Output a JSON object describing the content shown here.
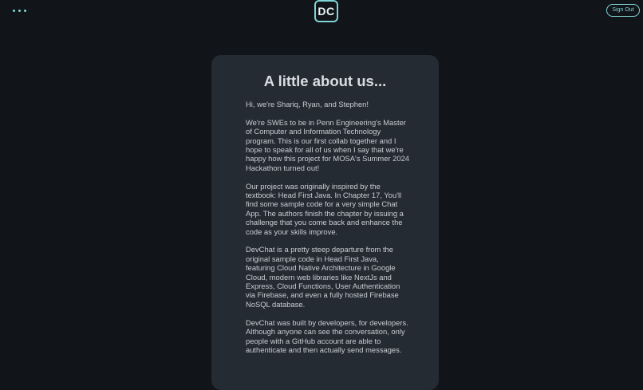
{
  "header": {
    "logo_text": "DC",
    "signout_label": "Sign Out",
    "menu_icon": "more-horizontal-icon"
  },
  "about": {
    "title": "A little about us...",
    "paragraphs": [
      "Hi, we're Shariq, Ryan, and Stephen!",
      "We're SWEs to be in Penn Engineering's Master of Computer and Information Technology program. This is our first collab together and I hope to speak for all of us when I say that we're happy how this project for MOSA's Summer 2024 Hackathon turned out!",
      "Our project was originally inspired by the textbook: Head First Java. In Chapter 17, You'll find some sample code for a very simple Chat App. The authors finish the chapter by issuing a challenge that you come back and enhance the code as your skills improve.",
      "DevChat is a pretty steep departure from the original sample code in Head First Java, featuring Cloud Native Architecture in Google Cloud, modern web libraries like NextJs and Express, Cloud Functions, User Authentication via Firebase, and even a fully hosted Firebase NoSQL database.",
      "DevChat was built by developers, for developers. Although anyone can see the conversation, only people with a GitHub account are able to authenticate and then actually send messages."
    ]
  },
  "colors": {
    "background": "#111418",
    "card": "#252b33",
    "accent": "#7fd4d4"
  }
}
